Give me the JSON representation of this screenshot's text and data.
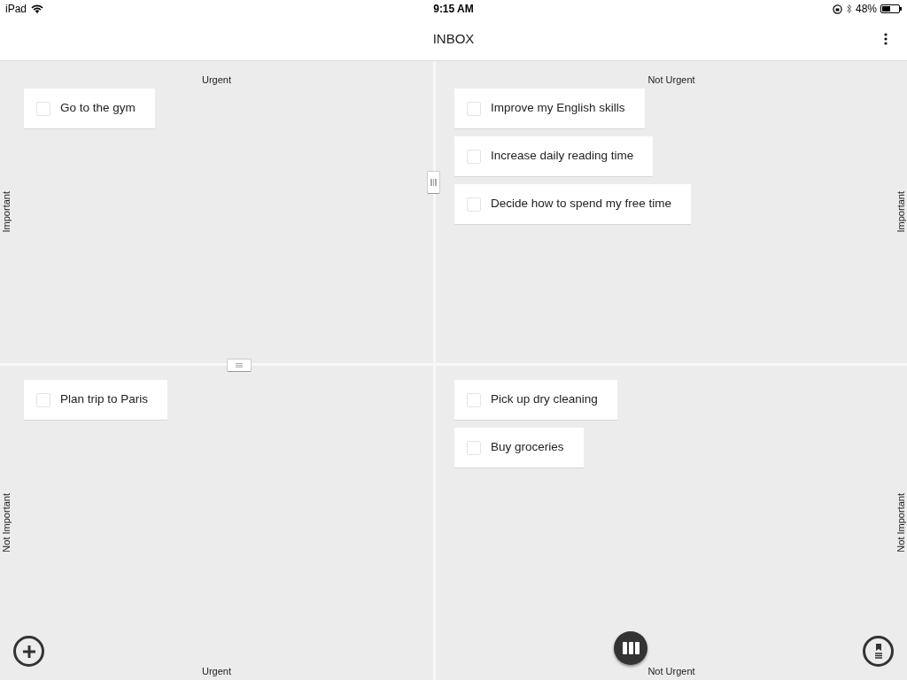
{
  "status_bar": {
    "device": "iPad",
    "time": "9:15 AM",
    "battery": "48%"
  },
  "header": {
    "title": "INBOX"
  },
  "quadrants": [
    {
      "column_label": "Urgent",
      "row_label": "Important",
      "tasks": [
        {
          "text": "Go to the gym",
          "checked": false
        }
      ]
    },
    {
      "column_label": "Not Urgent",
      "row_label": "Important",
      "tasks": [
        {
          "text": "Improve my English skills",
          "checked": false
        },
        {
          "text": "Increase daily reading time",
          "checked": false
        },
        {
          "text": "Decide how to spend my free time",
          "checked": false
        }
      ]
    },
    {
      "column_label": "Urgent",
      "row_label": "Not Important",
      "tasks": [
        {
          "text": "Plan trip to Paris",
          "checked": false
        }
      ]
    },
    {
      "column_label": "Not Urgent",
      "row_label": "Not Important",
      "tasks": [
        {
          "text": "Pick up dry cleaning",
          "checked": false
        },
        {
          "text": "Buy groceries",
          "checked": false
        }
      ]
    }
  ]
}
